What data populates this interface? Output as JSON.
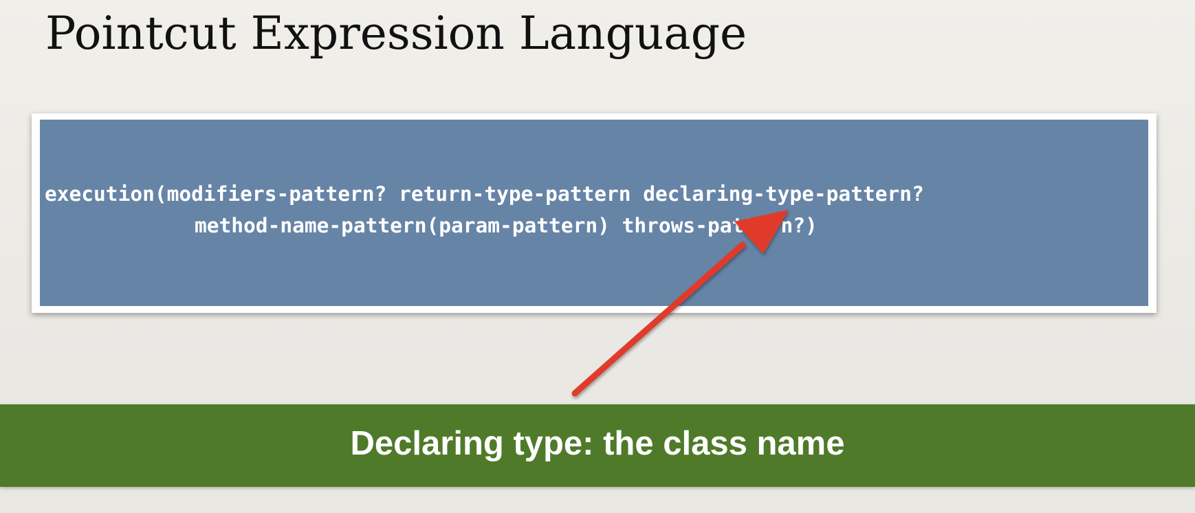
{
  "slide": {
    "title": "Pointcut Expression Language",
    "code_lines": [
      "execution(modifiers-pattern? return-type-pattern declaring-type-pattern?",
      "method-name-pattern(param-pattern) throws-pattern?)"
    ],
    "callout": "Declaring type: the class name"
  },
  "colors": {
    "code_box": "#6684a6",
    "banner": "#4f7a29",
    "arrow": "#e03b2b"
  },
  "icons": {
    "pointer": "arrow-icon"
  }
}
